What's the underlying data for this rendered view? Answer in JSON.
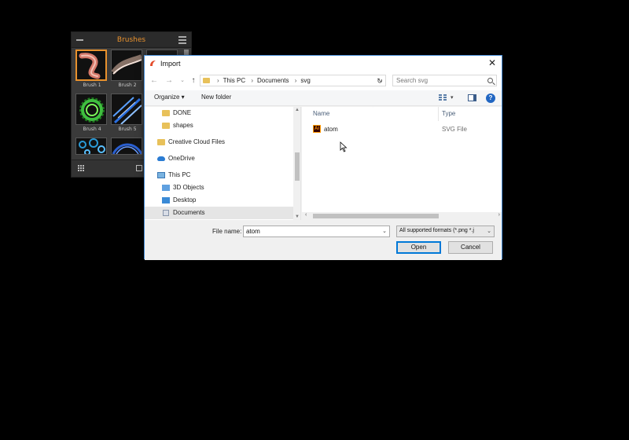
{
  "brushes_panel": {
    "title": "Brushes",
    "items": [
      {
        "label": "Brush 1",
        "selected": true
      },
      {
        "label": "Brush 2",
        "selected": false
      },
      {
        "label": "",
        "selected": false
      },
      {
        "label": "Brush 4",
        "selected": false
      },
      {
        "label": "Brush 5",
        "selected": false
      },
      {
        "label": "",
        "selected": false
      },
      {
        "label": "",
        "selected": false
      },
      {
        "label": "",
        "selected": false
      }
    ]
  },
  "dialog": {
    "title": "Import",
    "address": {
      "crumbs": [
        "This PC",
        "Documents",
        "svg"
      ]
    },
    "search_placeholder": "Search svg",
    "toolbar": {
      "organize": "Organize ▾",
      "new_folder": "New folder"
    },
    "nav": [
      {
        "label": "DONE",
        "icon": "folder-icon"
      },
      {
        "label": "shapes",
        "icon": "folder-icon"
      },
      {
        "label": "Creative Cloud Files",
        "icon": "creative-cloud-folder-icon"
      },
      {
        "label": "OneDrive",
        "icon": "onedrive-icon"
      },
      {
        "label": "This PC",
        "icon": "this-pc-icon"
      },
      {
        "label": "3D Objects",
        "icon": "3d-objects-icon"
      },
      {
        "label": "Desktop",
        "icon": "desktop-icon"
      },
      {
        "label": "Documents",
        "icon": "documents-icon",
        "selected": true
      }
    ],
    "columns": {
      "name": "Name",
      "type": "Type"
    },
    "files": [
      {
        "name": "atom",
        "type": "SVG File",
        "icon": "illustrator-file-icon"
      }
    ],
    "file_name_label": "File name:",
    "file_name_value": "atom",
    "filter_value": "All supported formats (*.png *.j",
    "open_label": "Open",
    "cancel_label": "Cancel"
  },
  "colors": {
    "accent_orange": "#e8912d",
    "window_border": "#4a90d9",
    "primary_button_border": "#0078d7"
  }
}
